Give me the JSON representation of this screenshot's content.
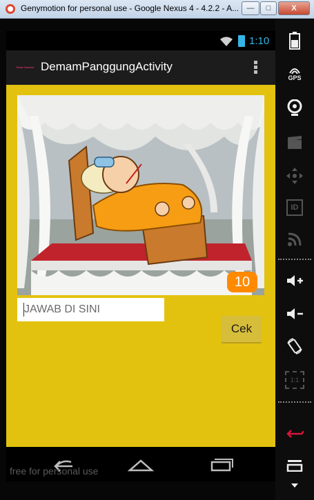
{
  "window": {
    "title": "Genymotion for personal use - Google Nexus 4 - 4.2.2 - A...",
    "minimize_label": "—",
    "maximize_label": "□",
    "close_label": "X"
  },
  "status_bar": {
    "time": "1:10",
    "accent_color": "#33b5e5"
  },
  "action_bar": {
    "app_icon_text": "Tebak Gambar",
    "title": "DemamPanggungActivity"
  },
  "game": {
    "score": "10",
    "answer_placeholder": "JAWAB DI SINI",
    "answer_value": "",
    "check_label": "Cek",
    "background_color": "#e2c20f",
    "badge_color": "#ff8a00"
  },
  "nav_bar": {
    "watermark": "free for personal use"
  },
  "side_panel": {
    "gps_label": "GPS",
    "id_label": "ID",
    "scale_label": "1:1"
  }
}
